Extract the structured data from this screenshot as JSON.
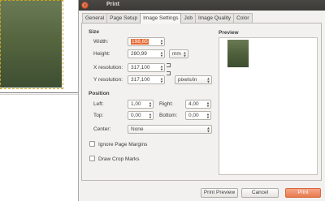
{
  "dialog": {
    "title": "Print",
    "tabs": [
      {
        "label": "General"
      },
      {
        "label": "Page Setup"
      },
      {
        "label": "Image Settings"
      },
      {
        "label": "Job"
      },
      {
        "label": "Image Quality"
      },
      {
        "label": "Color"
      }
    ],
    "active_tab": "Image Settings"
  },
  "size": {
    "heading": "Size",
    "width_label": "Width:",
    "width_value": "198,65",
    "height_label": "Height:",
    "height_value": "280,99",
    "unit": "mm",
    "x_res_label": "X resolution:",
    "x_res_value": "317,100",
    "y_res_label": "Y resolution:",
    "y_res_value": "317,100",
    "res_unit": "pixels/in"
  },
  "position": {
    "heading": "Position",
    "left_label": "Left:",
    "left_value": "1,00",
    "right_label": "Right:",
    "right_value": "4,00",
    "top_label": "Top:",
    "top_value": "0,00",
    "bottom_label": "Bottom:",
    "bottom_value": "0,00",
    "center_label": "Center:",
    "center_value": "None"
  },
  "options": {
    "ignore_margins_label": "Ignore Page Margins",
    "ignore_margins_checked": false,
    "crop_marks_label": "Draw Crop Marks",
    "crop_marks_checked": false
  },
  "preview": {
    "heading": "Preview"
  },
  "buttons": {
    "print_preview": "Print Preview",
    "cancel": "Cancel",
    "print": "Print"
  },
  "colors": {
    "accent": "#e77a4e",
    "titlebar": "#3c3b37"
  }
}
